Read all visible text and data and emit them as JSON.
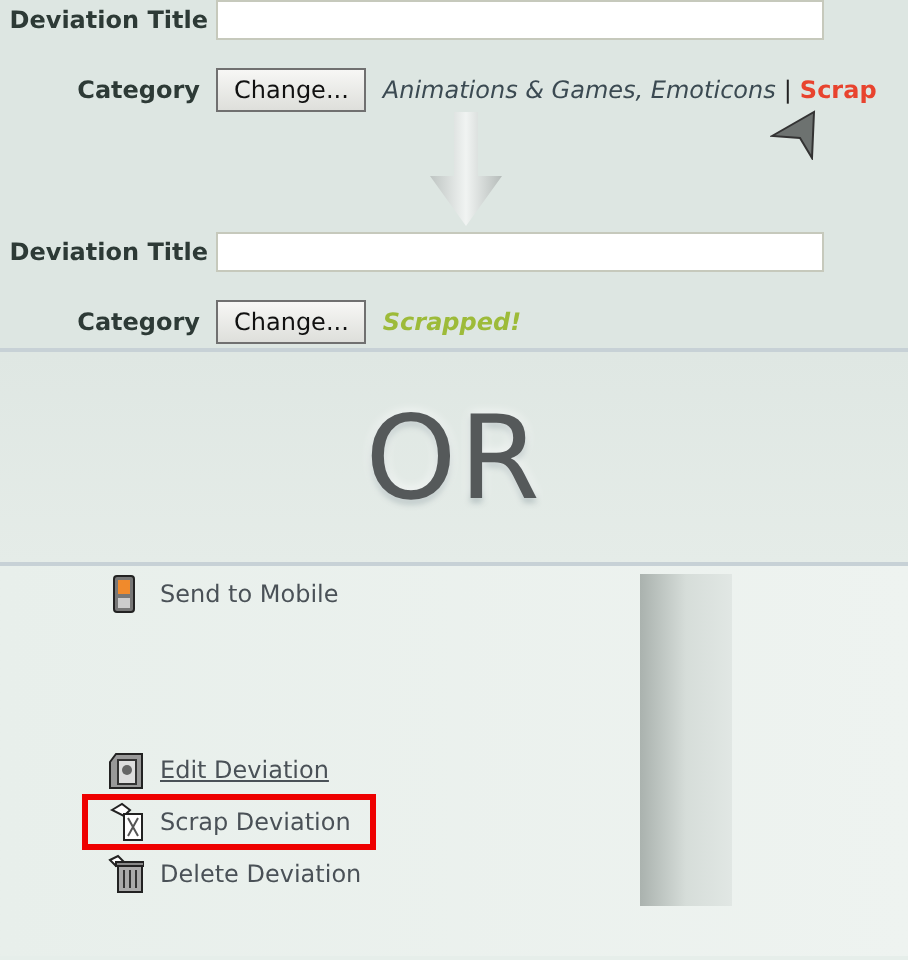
{
  "before": {
    "title_label": "Deviation Title",
    "category_label": "Category",
    "button": "Change...",
    "category_path": "Animations & Games, Emoticons",
    "separator": "|",
    "scrap_link": "Scrap"
  },
  "after": {
    "title_label": "Deviation Title",
    "category_label": "Category",
    "button": "Change...",
    "status": "Scrapped!"
  },
  "divider_text": "OR",
  "menu": [
    {
      "kind": "mobile",
      "label": "Send to Mobile",
      "underlined": false,
      "highlighted": false
    },
    {
      "kind": "edit",
      "label": "Edit Deviation",
      "underlined": true,
      "highlighted": false
    },
    {
      "kind": "scrap",
      "label": "Scrap Deviation",
      "underlined": false,
      "highlighted": true
    },
    {
      "kind": "delete",
      "label": "Delete Deviation",
      "underlined": false,
      "highlighted": false
    }
  ]
}
